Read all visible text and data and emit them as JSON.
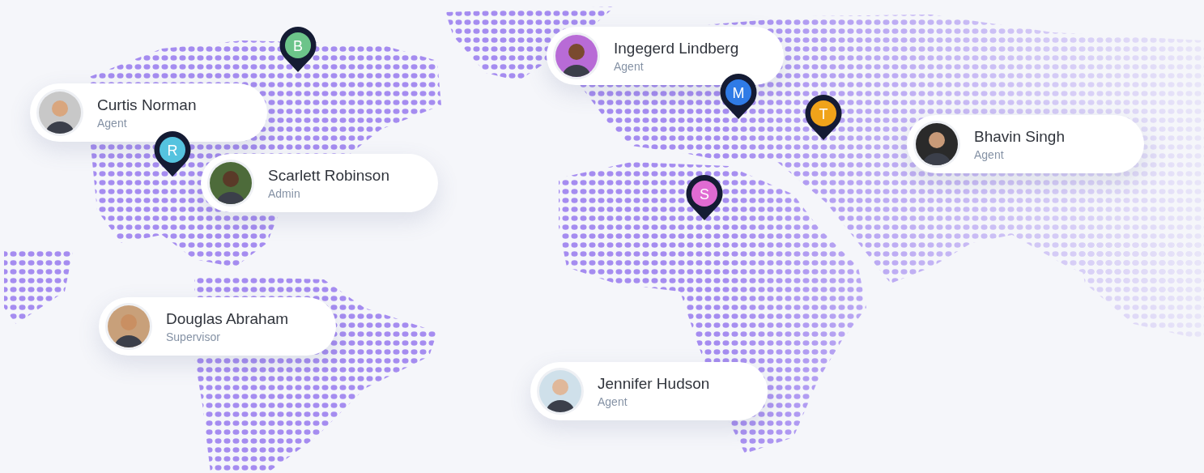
{
  "pins": [
    {
      "letter": "B",
      "color": "#6cc48a"
    },
    {
      "letter": "M",
      "color": "#2f7be6"
    },
    {
      "letter": "T",
      "color": "#f0a31a"
    },
    {
      "letter": "R",
      "color": "#55c3df"
    },
    {
      "letter": "S",
      "color": "#e06bd2"
    }
  ],
  "people": [
    {
      "name": "Ingegerd Lindberg",
      "role": "Agent"
    },
    {
      "name": "Curtis Norman",
      "role": "Agent"
    },
    {
      "name": "Scarlett Robinson",
      "role": "Admin"
    },
    {
      "name": "Bhavin Singh",
      "role": "Agent"
    },
    {
      "name": "Douglas Abraham",
      "role": "Supervisor"
    },
    {
      "name": "Jennifer Hudson",
      "role": "Agent"
    }
  ]
}
